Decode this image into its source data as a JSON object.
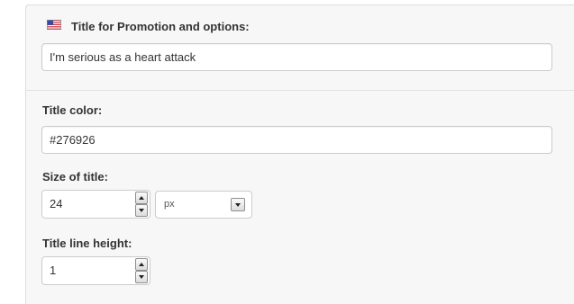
{
  "promotion": {
    "title_label": "Title for Promotion and options:",
    "title_value": "I'm serious as a heart attack",
    "flag_icon": "us-flag-icon"
  },
  "title_color": {
    "label": "Title color:",
    "value": "#276926"
  },
  "title_size": {
    "label": "Size of title:",
    "value": "24",
    "unit_selected": "px"
  },
  "line_height": {
    "label": "Title line height:",
    "value": "1"
  },
  "colors": {
    "panel_bg": "#f7f7f7",
    "border": "#cccccc",
    "label_text": "#333333"
  }
}
